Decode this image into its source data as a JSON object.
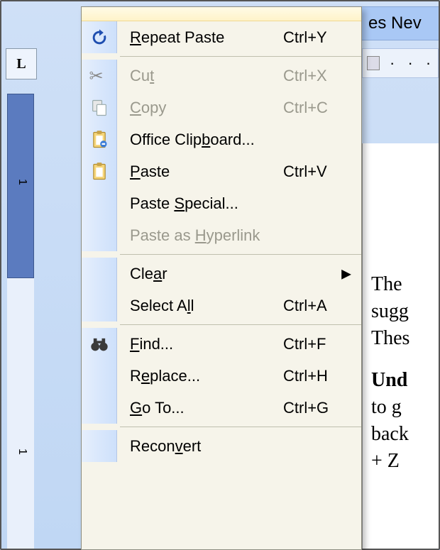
{
  "toolbar_fragment": "es Nev",
  "corner_marker": "L",
  "hruler_dots": "· · ·",
  "page_lines": [
    "The ",
    "sugg",
    "Thes",
    "Und",
    "to g",
    "back",
    "+ Z"
  ],
  "menu": {
    "items": [
      {
        "id": "repeat",
        "label_pre": "",
        "mnem": "R",
        "label_post": "epeat Paste",
        "shortcut": "Ctrl+Y",
        "icon": "undo-repeat-icon",
        "enabled": true,
        "sep_after": true
      },
      {
        "id": "cut",
        "label_pre": "Cu",
        "mnem": "t",
        "label_post": "",
        "shortcut": "Ctrl+X",
        "icon": "scissors-icon",
        "enabled": false,
        "sep_after": false
      },
      {
        "id": "copy",
        "label_pre": "",
        "mnem": "C",
        "label_post": "opy",
        "shortcut": "Ctrl+C",
        "icon": "copy-icon",
        "enabled": false,
        "sep_after": false
      },
      {
        "id": "office-clip",
        "label_pre": "Office Clip",
        "mnem": "b",
        "label_post": "oard...",
        "shortcut": "",
        "icon": "clipboard-pane-icon",
        "enabled": true,
        "sep_after": false
      },
      {
        "id": "paste",
        "label_pre": "",
        "mnem": "P",
        "label_post": "aste",
        "shortcut": "Ctrl+V",
        "icon": "paste-icon",
        "enabled": true,
        "sep_after": false
      },
      {
        "id": "paste-special",
        "label_pre": "Paste ",
        "mnem": "S",
        "label_post": "pecial...",
        "shortcut": "",
        "icon": "",
        "enabled": true,
        "sep_after": false
      },
      {
        "id": "paste-hyper",
        "label_pre": "Paste as ",
        "mnem": "H",
        "label_post": "yperlink",
        "shortcut": "",
        "icon": "",
        "enabled": false,
        "sep_after": true
      },
      {
        "id": "clear",
        "label_pre": "Cle",
        "mnem": "a",
        "label_post": "r",
        "shortcut": "",
        "icon": "",
        "enabled": true,
        "submenu": true,
        "sep_after": false
      },
      {
        "id": "select-all",
        "label_pre": "Select A",
        "mnem": "l",
        "label_post": "l",
        "shortcut": "Ctrl+A",
        "icon": "",
        "enabled": true,
        "sep_after": true
      },
      {
        "id": "find",
        "label_pre": "",
        "mnem": "F",
        "label_post": "ind...",
        "shortcut": "Ctrl+F",
        "icon": "binoculars-icon",
        "enabled": true,
        "sep_after": false
      },
      {
        "id": "replace",
        "label_pre": "R",
        "mnem": "e",
        "label_post": "place...",
        "shortcut": "Ctrl+H",
        "icon": "",
        "enabled": true,
        "sep_after": false
      },
      {
        "id": "goto",
        "label_pre": "",
        "mnem": "G",
        "label_post": "o To...",
        "shortcut": "Ctrl+G",
        "icon": "",
        "enabled": true,
        "sep_after": true
      },
      {
        "id": "reconvert",
        "label_pre": "Recon",
        "mnem": "v",
        "label_post": "ert",
        "shortcut": "",
        "icon": "",
        "enabled": true,
        "sep_after": false
      }
    ]
  },
  "colors": {
    "menu_bg": "#f6f4ea",
    "icon_strip": "#dce8fb",
    "highlight": "#316ac5"
  }
}
